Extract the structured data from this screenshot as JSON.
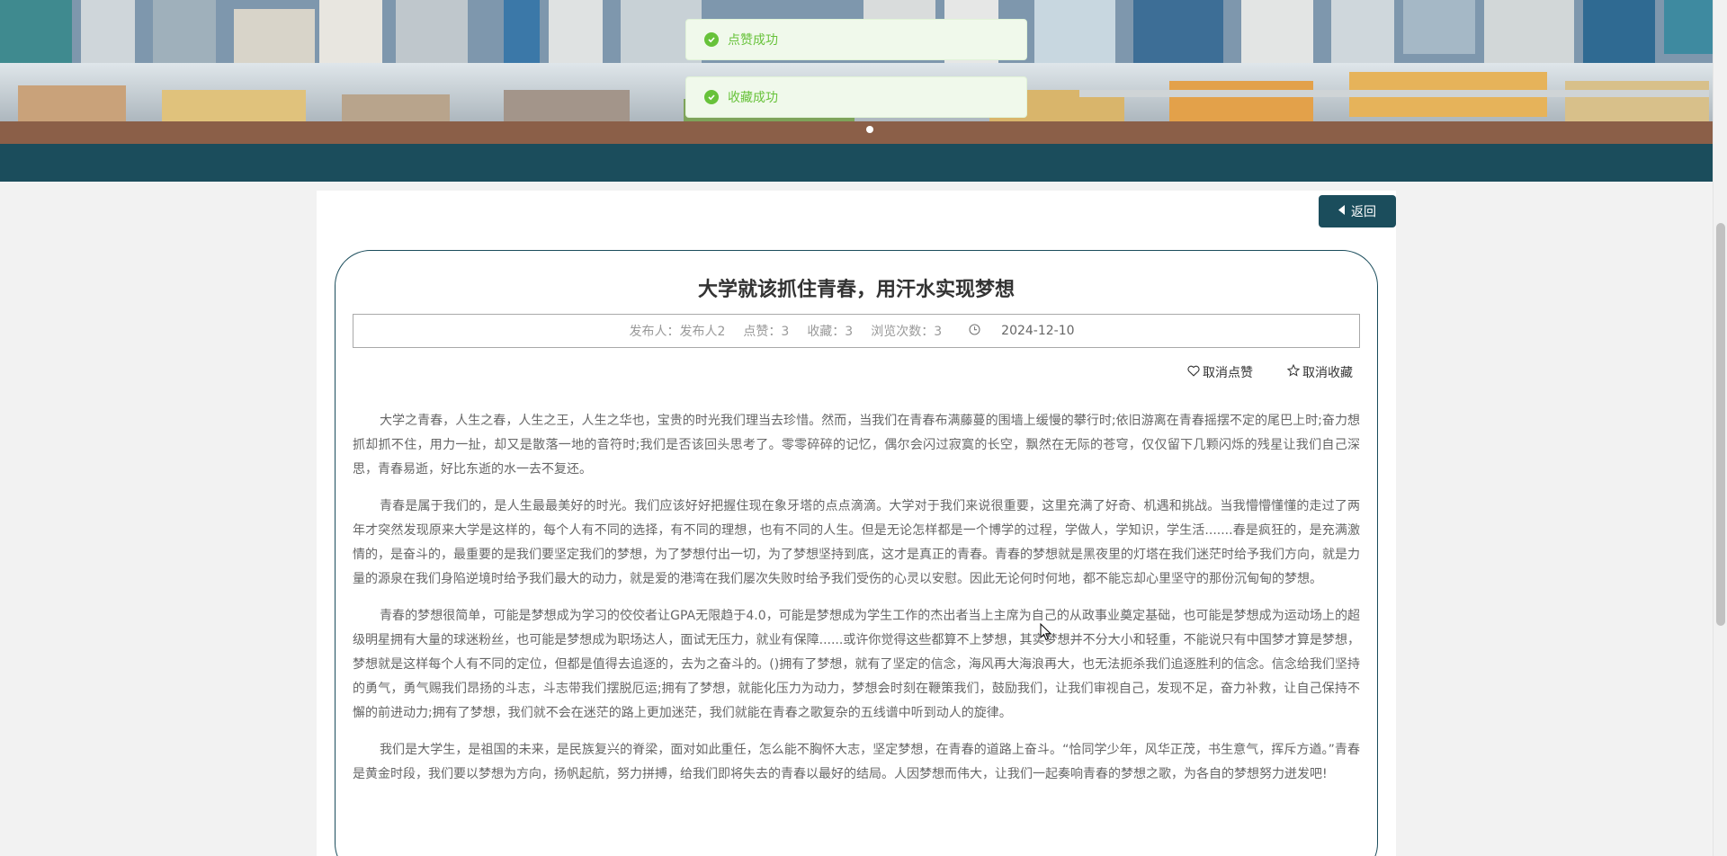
{
  "toasts": [
    {
      "message": "点赞成功"
    },
    {
      "message": "收藏成功"
    }
  ],
  "toolbar": {
    "back_label": "返回"
  },
  "article": {
    "title": "大学就该抓住青春，用汗水实现梦想",
    "meta": {
      "publisher": "发布人：发布人2",
      "likes": "点赞：3",
      "favorites": "收藏：3",
      "views": "浏览次数：3",
      "date": "2024-12-10"
    },
    "actions": {
      "unlike": "取消点赞",
      "unfavorite": "取消收藏"
    },
    "paragraphs": [
      "大学之青春，人生之春，人生之王，人生之华也，宝贵的时光我们理当去珍惜。然而，当我们在青春布满藤蔓的围墙上缓慢的攀行时;依旧游离在青春摇摆不定的尾巴上时;奋力想抓却抓不住，用力一扯，却又是散落一地的音符时;我们是否该回头思考了。零零碎碎的记忆，偶尔会闪过寂寞的长空，飘然在无际的苍穹，仅仅留下几颗闪烁的残星让我们自己深思，青春易逝，好比东逝的水一去不复还。",
      "青春是属于我们的，是人生最最美好的时光。我们应该好好把握住现在象牙塔的点点滴滴。大学对于我们来说很重要，这里充满了好奇、机遇和挑战。当我懵懵懂懂的走过了两年才突然发现原来大学是这样的，每个人有不同的选择，有不同的理想，也有不同的人生。但是无论怎样都是一个博学的过程，学做人，学知识，学生活.......春是疯狂的，是充满激情的，是奋斗的，最重要的是我们要坚定我们的梦想，为了梦想付出一切，为了梦想坚持到底，这才是真正的青春。青春的梦想就是黑夜里的灯塔在我们迷茫时给予我们方向，就是力量的源泉在我们身陷逆境时给予我们最大的动力，就是爱的港湾在我们屡次失败时给予我们受伤的心灵以安慰。因此无论何时何地，都不能忘却心里坚守的那份沉甸甸的梦想。",
      "青春的梦想很简单，可能是梦想成为学习的佼佼者让GPA无限趋于4.0，可能是梦想成为学生工作的杰出者当上主席为自己的从政事业奠定基础，也可能是梦想成为运动场上的超级明星拥有大量的球迷粉丝，也可能是梦想成为职场达人，面试无压力，就业有保障......或许你觉得这些都算不上梦想，其实梦想并不分大小和轻重，不能说只有中国梦才算是梦想，梦想就是这样每个人有不同的定位，但都是值得去追逐的，去为之奋斗的。()拥有了梦想，就有了坚定的信念，海风再大海浪再大，也无法扼杀我们追逐胜利的信念。信念给我们坚持的勇气，勇气赐我们昂扬的斗志，斗志带我们摆脱厄运;拥有了梦想，就能化压力为动力，梦想会时刻在鞭策我们，鼓励我们，让我们审视自己，发现不足，奋力补救，让自己保持不懈的前进动力;拥有了梦想，我们就不会在迷茫的路上更加迷茫，我们就能在青春之歌复杂的五线谱中听到动人的旋律。",
      "我们是大学生，是祖国的未来，是民族复兴的脊梁，面对如此重任，怎么能不胸怀大志，坚定梦想，在青春的道路上奋斗。“恰同学少年，风华正茂，书生意气，挥斥方遒。”青春是黄金时段，我们要以梦想为方向，扬帆起航，努力拼搏，给我们即将失去的青春以最好的结局。人因梦想而伟大，让我们一起奏响青春的梦想之歌，为各自的梦想努力迸发吧!"
    ]
  }
}
